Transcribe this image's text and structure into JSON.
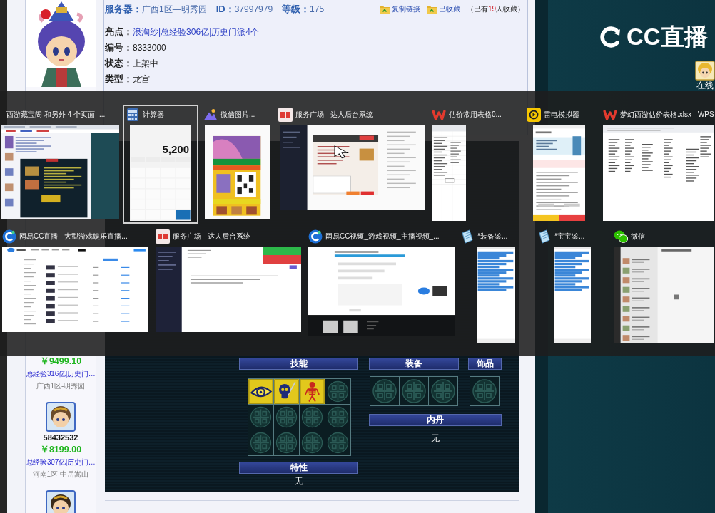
{
  "listing": {
    "fields": [
      {
        "label": "服务器：",
        "value": "广西1区—明秀园"
      },
      {
        "label": "ID：",
        "value": "37997979"
      },
      {
        "label": "等级：",
        "value": "175"
      }
    ],
    "actions": [
      {
        "label": "复制链接"
      },
      {
        "label": "已收藏"
      }
    ],
    "favorites": {
      "prefix": "（已有",
      "count": "19",
      "suffix": "人收藏）"
    },
    "details": [
      {
        "label": "亮点：",
        "value": "浪淘纱|总经验306亿|历史门派4个",
        "kind": "link"
      },
      {
        "label": "编号：",
        "value": "8333000",
        "kind": "text"
      },
      {
        "label": "状态：",
        "value": "上架中",
        "kind": "text"
      },
      {
        "label": "类型：",
        "value": "龙宫",
        "kind": "text"
      }
    ]
  },
  "pet_panel": {
    "skills": {
      "title": "技能",
      "slots": [
        {
          "filled": true
        },
        {
          "filled": true
        },
        {
          "filled": true
        },
        {
          "filled": false
        },
        {
          "filled": false
        },
        {
          "filled": false
        },
        {
          "filled": false
        },
        {
          "filled": false
        },
        {
          "filled": false
        },
        {
          "filled": false
        },
        {
          "filled": false
        },
        {
          "filled": false
        }
      ]
    },
    "equipment": {
      "title": "装备",
      "slots": [
        {
          "filled": false
        },
        {
          "filled": false
        },
        {
          "filled": false
        }
      ]
    },
    "accessory": {
      "title": "饰品",
      "slots": [
        {
          "filled": false
        }
      ]
    },
    "inner_core": {
      "title": "内丹",
      "value": "无"
    },
    "traits": {
      "title": "特性",
      "value": "无"
    }
  },
  "similar_items": [
    {
      "avatar": false,
      "price": "￥9499.10",
      "highlights": "总经验316亿|历史门…",
      "server": "广西1区-明秀园"
    },
    {
      "avatar": true,
      "id": "58432532",
      "price": "￥8199.00",
      "highlights": "总经验307亿|历史门…",
      "server": "河南1区-中岳嵩山"
    },
    {
      "avatar": true
    }
  ],
  "side_panel": {
    "logo": "CC直播",
    "status": "在线"
  },
  "task_switcher": {
    "rows": [
      {
        "windows": [
          {
            "title": "西游藏宝阁 和另外 4 个页面 -...",
            "preview": {
              "kind": "browser"
            },
            "selected": false
          },
          {
            "title": "计算器",
            "icon": {
              "kind": "calculator"
            },
            "preview": {
              "kind": "calculator",
              "display": "5,200"
            },
            "selected": true
          },
          {
            "title": "微信图片...",
            "icon": {
              "kind": "photos"
            },
            "preview": {
              "kind": "poster"
            },
            "selected": false
          },
          {
            "title": "服务广场 - 达人后台系统",
            "icon": {
              "kind": "service"
            },
            "preview": {
              "kind": "admin"
            },
            "selected": false
          },
          {
            "title": "估价常用表格0...",
            "icon": {
              "kind": "wps"
            },
            "preview": {
              "kind": "sheet"
            },
            "selected": false
          },
          {
            "title": "雷电模拟器",
            "icon": {
              "kind": "emulator"
            },
            "preview": {
              "kind": "phone"
            },
            "selected": false
          },
          {
            "title": "梦幻西游估价表格.xlsx - WPS",
            "icon": {
              "kind": "wps"
            },
            "preview": {
              "kind": "sheet_wide"
            },
            "selected": false
          }
        ]
      },
      {
        "windows": [
          {
            "title": "网易CC直播 - 大型游戏娱乐直播...",
            "icon": {
              "kind": "cc"
            },
            "preview": {
              "kind": "listing_site"
            },
            "selected": false
          },
          {
            "title": "服务广场 - 达人后台系统",
            "icon": {
              "kind": "service"
            },
            "preview": {
              "kind": "admin_toasts"
            },
            "selected": false
          },
          {
            "title": "网易CC视频_游戏视频_主播视频_...",
            "icon": {
              "kind": "cc"
            },
            "preview": {
              "kind": "video_site"
            },
            "selected": false
          },
          {
            "title": "*装备鉴...",
            "icon": {
              "kind": "notepad"
            },
            "preview": {
              "kind": "notepad"
            },
            "selected": false
          },
          {
            "title": "*宝宝鉴...",
            "icon": {
              "kind": "notepad"
            },
            "preview": {
              "kind": "notepad"
            },
            "selected": false
          },
          {
            "title": "微信",
            "icon": {
              "kind": "wechat"
            },
            "preview": {
              "kind": "chat"
            },
            "selected": false
          }
        ]
      }
    ]
  }
}
